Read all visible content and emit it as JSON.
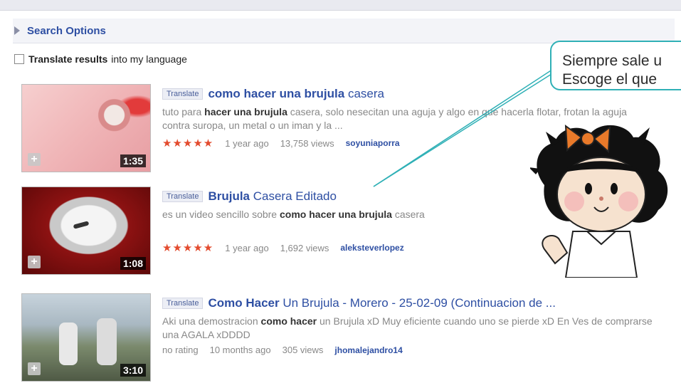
{
  "search_options": {
    "label": "Search Options"
  },
  "translate_results": {
    "bold": "Translate results",
    "rest": "into my language"
  },
  "callout": {
    "line1": "Siempre sale u",
    "line2": "Escoge el que"
  },
  "results": [
    {
      "translate": "Translate",
      "title_bold": "como hacer una brujula",
      "title_rest": "casera",
      "desc_a": "tuto para ",
      "desc_b": "hacer una brujula",
      "desc_c": " casera, solo nesecitan una aguja y algo en que hacerla flotar, frotan la aguja contra suropa, un metal o un iman y la ...",
      "rating": "★★★★★",
      "age": "1 year ago",
      "views": "13,758 views",
      "author": "soyuniaporra",
      "duration": "1:35"
    },
    {
      "translate": "Translate",
      "title_bold": "Brujula",
      "title_rest": "Casera Editado",
      "desc_a": "es un video sencillo sobre ",
      "desc_b": "como hacer una brujula",
      "desc_c": " casera",
      "rating": "★★★★★",
      "age": "1 year ago",
      "views": "1,692 views",
      "author": "aleksteverlopez",
      "duration": "1:08"
    },
    {
      "translate": "Translate",
      "title_bold": "Como Hacer",
      "title_rest": "Un Brujula - Morero - 25-02-09 (Continuacion de ...",
      "desc_a": "Aki una demostracion ",
      "desc_b": "como hacer",
      "desc_c": " un Brujula xD Muy eficiente cuando uno se pierde xD En Ves de comprarse una AGALA xDDDD",
      "rating": "no rating",
      "age": "10 months ago",
      "views": "305 views",
      "author": "jhomalejandro14",
      "duration": "3:10"
    }
  ]
}
